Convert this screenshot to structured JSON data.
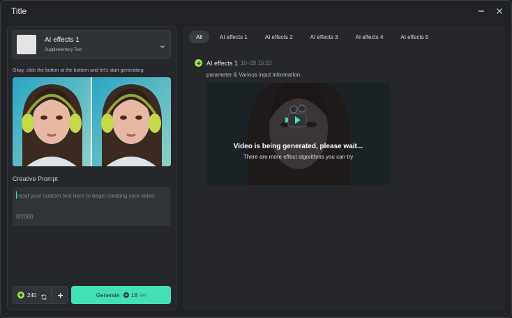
{
  "window": {
    "title": "Title"
  },
  "left_panel": {
    "effect": {
      "name": "AI effects 1",
      "sub": "Supplementory Text"
    },
    "hint": "Okay, click the button at the bottom and let's start generating",
    "prompt": {
      "label": "Creative Prompt",
      "placeholder": "Input your custom text here to begin creating your video.",
      "count": "0/2000"
    },
    "credits": {
      "value": "240"
    },
    "generate": {
      "label": "Generate",
      "cost": "18",
      "old_cost": "20"
    }
  },
  "right_panel": {
    "tabs": [
      {
        "label": "All"
      },
      {
        "label": "AI effects 1"
      },
      {
        "label": "AI effects 2"
      },
      {
        "label": "AI effects 3"
      },
      {
        "label": "AI effects 4"
      },
      {
        "label": "AI effects 5"
      }
    ],
    "entry": {
      "name": "AI effects 1",
      "time": "10–29 15:10",
      "params": "parameter & Various input information",
      "status_title": "Video is being generated, please wait...",
      "status_sub": "There are more effect algorithms you can try"
    }
  },
  "colors": {
    "accent": "#44e0b5",
    "plus_badge": "#9be04f",
    "background": "#202226"
  },
  "icons": [
    "minimize-icon",
    "close-icon",
    "chevron-down-icon",
    "plus-circle-icon",
    "refresh-icon",
    "plus-icon",
    "coin-icon",
    "video-camera-icon"
  ]
}
